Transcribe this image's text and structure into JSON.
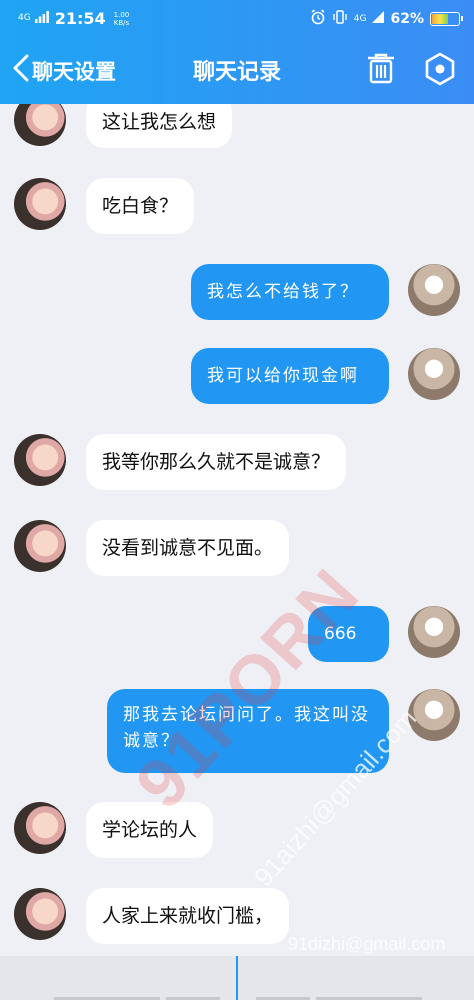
{
  "status_bar": {
    "network": "4G",
    "time": "21:54",
    "speed_value": "1.00",
    "speed_unit": "KB/s",
    "network_right": "4G",
    "battery_text": "62%",
    "battery_level": 0.62
  },
  "nav": {
    "back_label": "聊天设置",
    "title": "聊天记录"
  },
  "messages": [
    {
      "side": "left",
      "text": "这让我怎么想"
    },
    {
      "side": "left",
      "text": "吃白食？"
    },
    {
      "side": "right",
      "text": "我怎么不给钱了？"
    },
    {
      "side": "right",
      "text": "我可以给你现金啊"
    },
    {
      "side": "left",
      "text": "我等你那么久就不是诚意？"
    },
    {
      "side": "left",
      "text": "没看到诚意不见面。"
    },
    {
      "side": "right",
      "text": "666"
    },
    {
      "side": "right",
      "text": "那我去论坛问问了。我这叫没诚意？"
    },
    {
      "side": "left",
      "text": "学论坛的人"
    },
    {
      "side": "left",
      "text": "人家上来就收门槛，"
    }
  ],
  "watermarks": {
    "main": "91PORN",
    "email_large": "91aizhi@gmail.com",
    "email_small": "91dizhi@gmail.com"
  },
  "colors": {
    "header_start": "#1fa4f3",
    "header_end": "#3b8df5",
    "bubble_right": "#2196f3",
    "background": "#eef0f5"
  }
}
